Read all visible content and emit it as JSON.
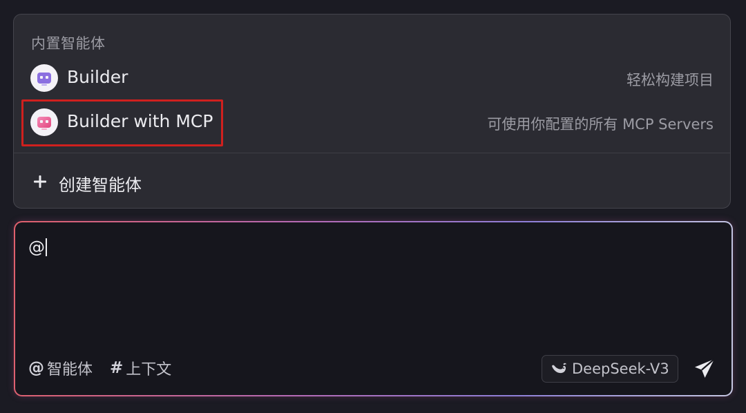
{
  "agent_menu": {
    "section_title": "内置智能体",
    "agents": [
      {
        "name": "Builder",
        "description": "轻松构建项目",
        "icon": "robot-icon",
        "icon_color": "#8b6fe0"
      },
      {
        "name": "Builder with MCP",
        "description": "可使用你配置的所有 MCP Servers",
        "icon": "robot-mcp-icon",
        "icon_color": "#f06aa8",
        "highlighted": true
      }
    ],
    "create_label": "创建智能体"
  },
  "chat_input": {
    "value": "@",
    "agents_chip": {
      "symbol": "@",
      "label": "智能体"
    },
    "context_chip": {
      "symbol": "#",
      "label": "上下文"
    },
    "model": {
      "label": "DeepSeek-V3",
      "icon": "deepseek-whale-icon"
    },
    "send_icon": "send-icon"
  },
  "colors": {
    "background": "#1b1b23",
    "panel": "#2b2b32",
    "highlight_border": "#d0201e",
    "input_border_gradient": [
      "#e0606c",
      "#b56ab6",
      "#8e7fd8",
      "#c6c8e2"
    ]
  }
}
